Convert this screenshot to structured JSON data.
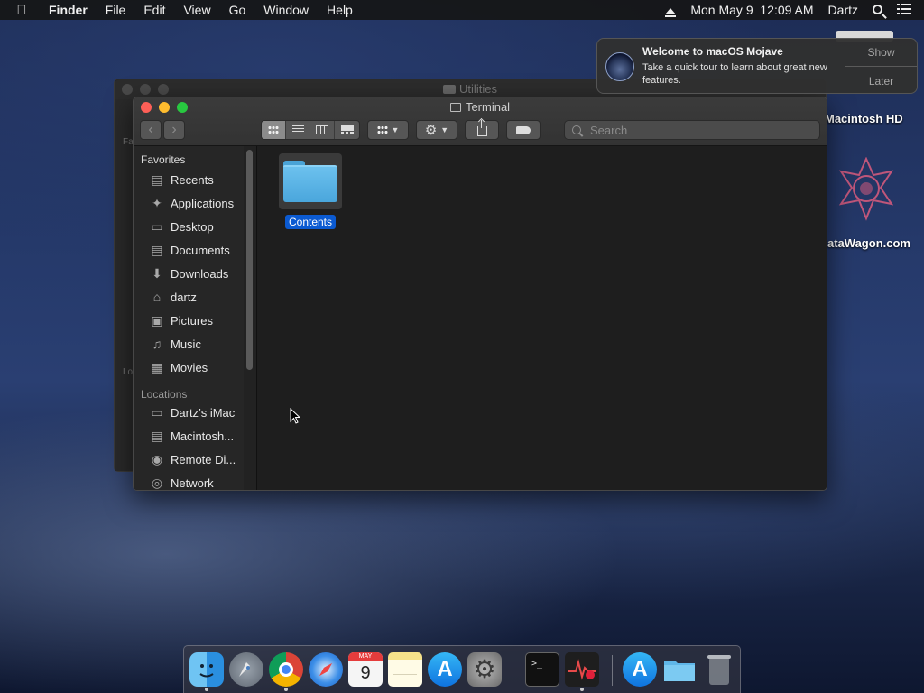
{
  "menubar": {
    "app": "Finder",
    "items": [
      "File",
      "Edit",
      "View",
      "Go",
      "Window",
      "Help"
    ],
    "datetime": "Mon May 9  12:09 AM",
    "user": "Dartz"
  },
  "desktop": {
    "drive_label": "Macintosh HD",
    "wagon_label": "ataWagon.com"
  },
  "back_window": {
    "title": "Utilities",
    "sidebar_fragments": [
      "Fa",
      "Lo"
    ]
  },
  "finder": {
    "title": "Terminal",
    "search_placeholder": "Search",
    "sidebar": {
      "favorites_header": "Favorites",
      "favorites": [
        {
          "label": "Recents",
          "icon": "recents-icon"
        },
        {
          "label": "Applications",
          "icon": "applications-icon"
        },
        {
          "label": "Desktop",
          "icon": "desktop-icon"
        },
        {
          "label": "Documents",
          "icon": "documents-icon"
        },
        {
          "label": "Downloads",
          "icon": "downloads-icon"
        },
        {
          "label": "dartz",
          "icon": "home-icon"
        },
        {
          "label": "Pictures",
          "icon": "pictures-icon"
        },
        {
          "label": "Music",
          "icon": "music-icon"
        },
        {
          "label": "Movies",
          "icon": "movies-icon"
        }
      ],
      "locations_header": "Locations",
      "locations": [
        {
          "label": "Dartz’s iMac",
          "icon": "imac-icon"
        },
        {
          "label": "Macintosh...",
          "icon": "disk-icon"
        },
        {
          "label": "Remote Di...",
          "icon": "remote-disc-icon"
        },
        {
          "label": "Network",
          "icon": "network-icon"
        }
      ]
    },
    "items": [
      {
        "name": "Contents",
        "kind": "folder",
        "selected": true
      }
    ]
  },
  "notification": {
    "title": "Welcome to macOS Mojave",
    "body": "Take a quick tour to learn about great new features.",
    "show": "Show",
    "later": "Later"
  },
  "dock": {
    "apps": [
      "Finder",
      "Launchpad",
      "Chrome",
      "Safari",
      "Calendar",
      "Notes",
      "App Store",
      "System Preferences",
      "Terminal",
      "Activity Monitor",
      "App Store Downloads",
      "Folder",
      "Trash"
    ],
    "calendar": {
      "month": "MAY",
      "day": "9"
    }
  },
  "colors": {
    "accent": "#0b5ad1",
    "folder": "#5fb6e8"
  }
}
